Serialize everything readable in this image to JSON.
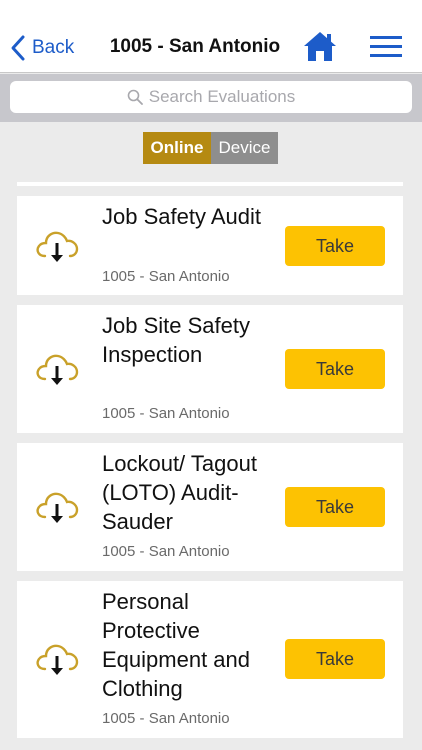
{
  "nav": {
    "back_label": "Back",
    "title": "1005 - San Antonio",
    "home_icon": "home-icon",
    "menu_icon": "hamburger-menu-icon"
  },
  "search": {
    "placeholder": "Search Evaluations"
  },
  "segment": {
    "online": "Online",
    "device": "Device",
    "selected": "Online"
  },
  "evaluations": [
    {
      "title": "Job Safety Audit",
      "location": "1005 - San Antonio",
      "action": "Take"
    },
    {
      "title": "Job Site Safety Inspection",
      "location": "1005 - San Antonio",
      "action": "Take"
    },
    {
      "title": "Lockout/ Tagout (LOTO) Audit- Sauder",
      "location": "1005 - San Antonio",
      "action": "Take"
    },
    {
      "title": "Personal Protective Equipment and Clothing",
      "location": "1005 - San Antonio",
      "action": "Take"
    }
  ],
  "colors": {
    "accent": "#1d5cc9",
    "take_button": "#fdc202",
    "online_segment": "#b58a12",
    "device_segment": "#8e8e8e"
  }
}
